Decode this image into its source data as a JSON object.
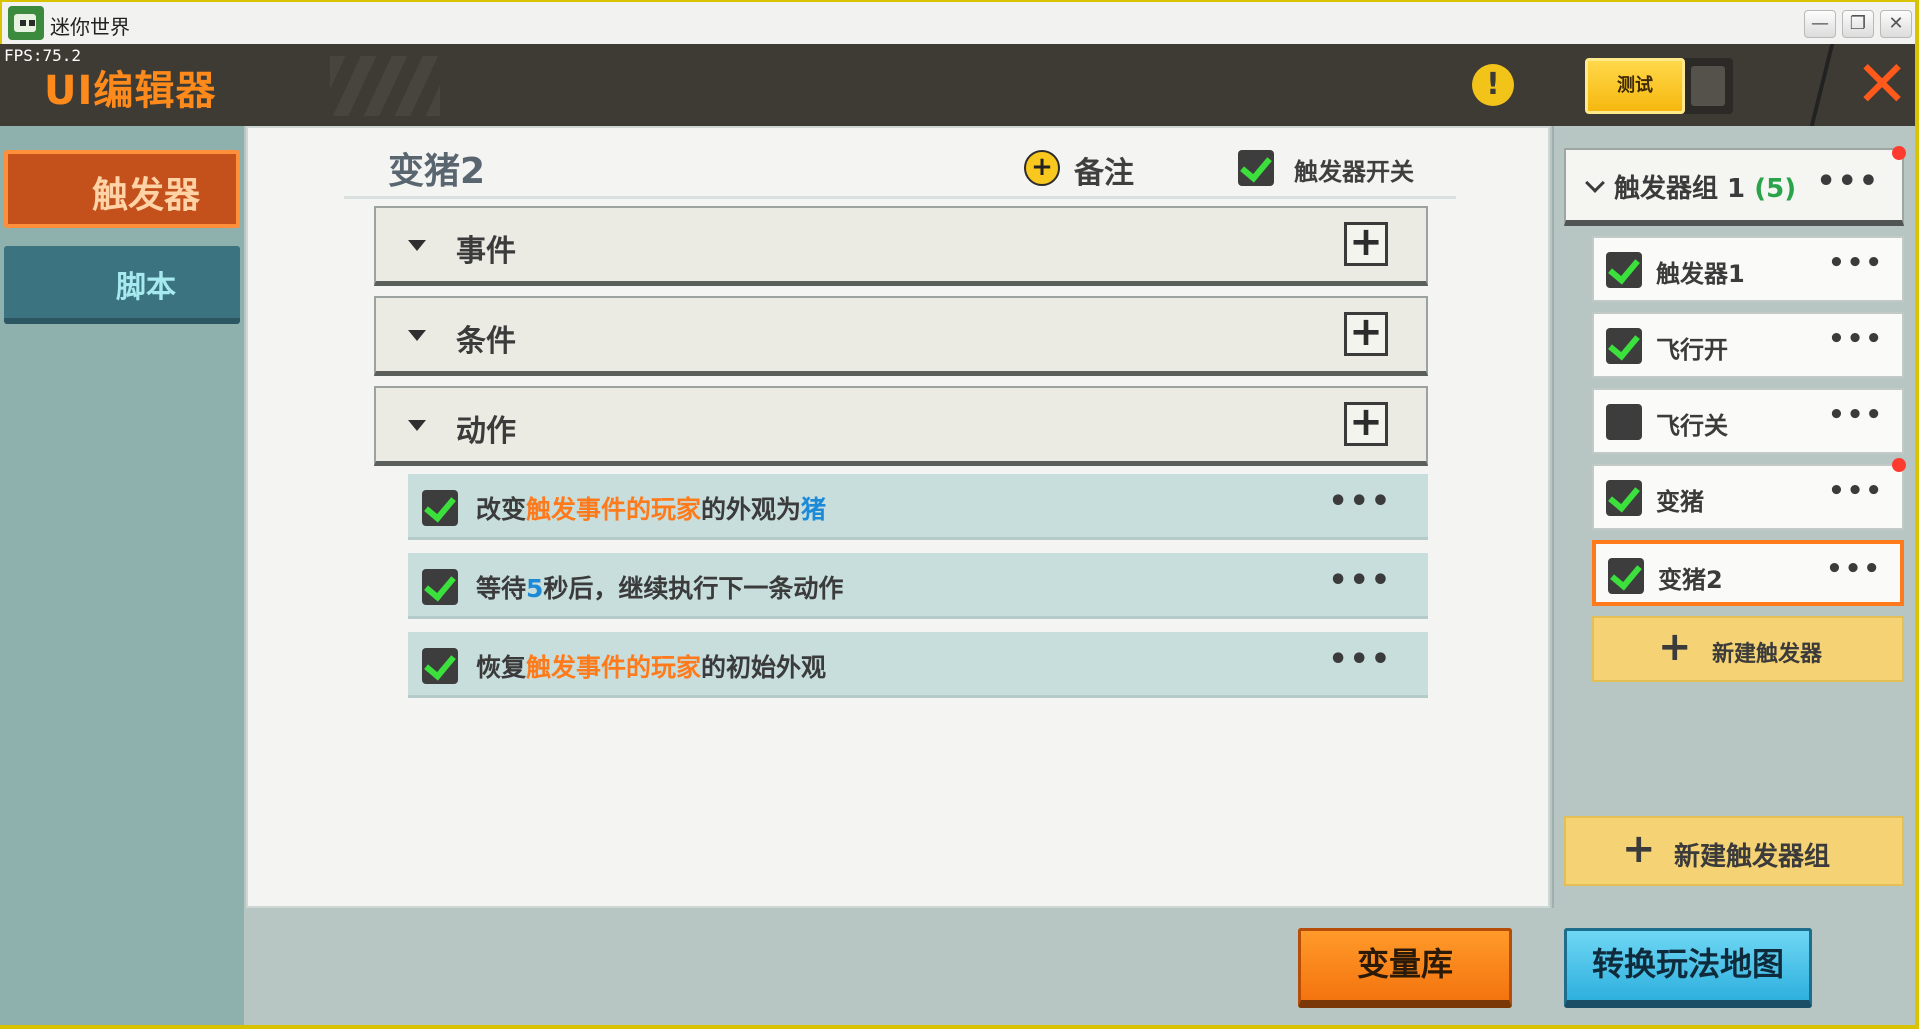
{
  "window": {
    "title": "迷你世界",
    "minimize": "—",
    "restore": "❐",
    "close": "✕"
  },
  "header": {
    "fps": "FPS:75.2",
    "title": "UI编辑器",
    "warning": "!",
    "test_label": "测试",
    "close": "✕"
  },
  "nav": {
    "items": [
      {
        "label": "触发器",
        "selected": true
      },
      {
        "label": "脚本",
        "selected": false
      }
    ]
  },
  "main": {
    "trigger_name": "变猪2",
    "note_icon": "+",
    "note_label": "备注",
    "switch_label": "触发器开关",
    "switch_checked": true,
    "sections": [
      {
        "label": "事件",
        "add": "+"
      },
      {
        "label": "条件",
        "add": "+"
      },
      {
        "label": "动作",
        "add": "+"
      }
    ],
    "actions": [
      {
        "parts": [
          "改变",
          "触发事件的玩家",
          "的外观为",
          "猪"
        ],
        "checked": true,
        "more": "•••"
      },
      {
        "parts": [
          "等待",
          "5",
          "秒后，继续执行下一条动作"
        ],
        "checked": true,
        "more": "•••"
      },
      {
        "parts": [
          "恢复",
          "触发事件的玩家",
          "的初始外观"
        ],
        "checked": true,
        "more": "•••"
      }
    ]
  },
  "sidebar": {
    "group": {
      "label": "触发器组 1",
      "count": "(5)",
      "more": "•••"
    },
    "triggers": [
      {
        "label": "触发器1",
        "checked": true,
        "more": "•••"
      },
      {
        "label": "飞行开",
        "checked": true,
        "more": "•••"
      },
      {
        "label": "飞行关",
        "checked": false,
        "more": "•••"
      },
      {
        "label": "变猪",
        "checked": true,
        "more": "•••"
      },
      {
        "label": "变猪2",
        "checked": true,
        "more": "•••",
        "selected": true
      }
    ],
    "new_trigger": {
      "plus": "+",
      "label": "新建触发器"
    },
    "new_group": {
      "plus": "+",
      "label": "新建触发器组"
    }
  },
  "footer": {
    "variables_label": "变量库",
    "convert_label": "转换玩法地图"
  },
  "colors": {
    "accent_orange": "#ff7a1a",
    "highlight_blue": "#1d8ad8",
    "check_green": "#3be03c",
    "header_dark": "#3e3b35"
  }
}
